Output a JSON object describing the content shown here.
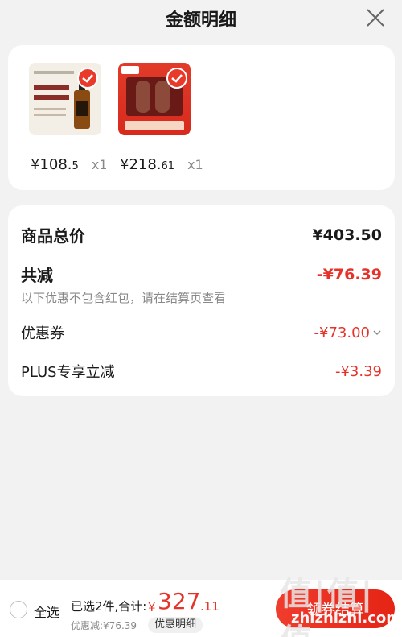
{
  "header": {
    "title": "金额明细",
    "close_icon": "close-icon"
  },
  "products": [
    {
      "image_icon": "whisky-bottle-image",
      "price_int": "¥108.",
      "price_dec": "5",
      "qty": "x1"
    },
    {
      "image_icon": "gift-box-image",
      "price_int": "¥218.",
      "price_dec": "61",
      "qty": "x1"
    }
  ],
  "summary": {
    "total_label": "商品总价",
    "total_value": "¥403.50",
    "reduce_label": "共减",
    "reduce_value": "-¥76.39",
    "reduce_note": "以下优惠不包含红包，请在结算页查看",
    "coupon_label": "优惠券",
    "coupon_value": "-¥73.00",
    "plus_label": "PLUS专享立减",
    "plus_value": "-¥3.39"
  },
  "bottom": {
    "select_all": "全选",
    "selected_info": "已选2件,合计:",
    "total_symbol": "¥",
    "total_int": "327",
    "total_dec": ".11",
    "discount_info": "优惠减:¥76.39",
    "detail_btn": "优惠明细",
    "checkout_btn": "领券结算"
  },
  "watermark": {
    "big": "值|值|值",
    "small": "zhizhizhi.com"
  },
  "colors": {
    "accent": "#e5332a",
    "background": "#f2f2f2"
  }
}
